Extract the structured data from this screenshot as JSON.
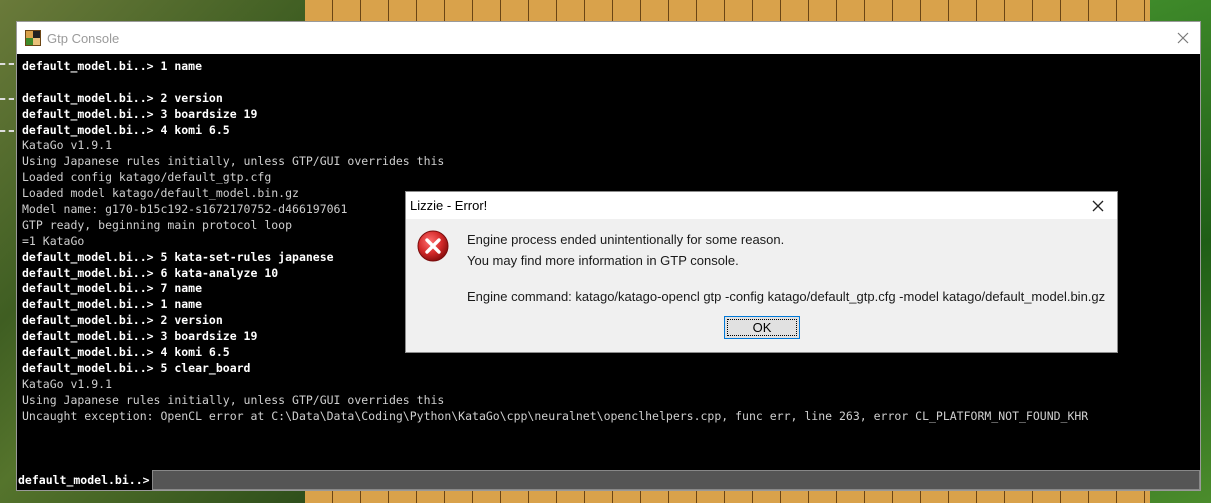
{
  "console": {
    "title": "Gtp Console",
    "log": [
      {
        "type": "cmd",
        "text": "default_model.bi..> 1 name"
      },
      {
        "type": "blank",
        "text": ""
      },
      {
        "type": "cmd",
        "text": "default_model.bi..> 2 version"
      },
      {
        "type": "cmd",
        "text": "default_model.bi..> 3 boardsize 19"
      },
      {
        "type": "cmd",
        "text": "default_model.bi..> 4 komi 6.5"
      },
      {
        "type": "out",
        "text": "KataGo v1.9.1"
      },
      {
        "type": "out",
        "text": "Using Japanese rules initially, unless GTP/GUI overrides this"
      },
      {
        "type": "out",
        "text": "Loaded config katago/default_gtp.cfg"
      },
      {
        "type": "out",
        "text": "Loaded model katago/default_model.bin.gz"
      },
      {
        "type": "out",
        "text": "Model name: g170-b15c192-s1672170752-d466197061"
      },
      {
        "type": "out",
        "text": "GTP ready, beginning main protocol loop"
      },
      {
        "type": "out",
        "text": "=1 KataGo"
      },
      {
        "type": "cmd",
        "text": "default_model.bi..> 5 kata-set-rules japanese"
      },
      {
        "type": "cmd",
        "text": "default_model.bi..> 6 kata-analyze 10"
      },
      {
        "type": "cmd",
        "text": "default_model.bi..> 7 name"
      },
      {
        "type": "cmd",
        "text": "default_model.bi..> 1 name"
      },
      {
        "type": "cmd",
        "text": "default_model.bi..> 2 version"
      },
      {
        "type": "cmd",
        "text": "default_model.bi..> 3 boardsize 19"
      },
      {
        "type": "cmd",
        "text": "default_model.bi..> 4 komi 6.5"
      },
      {
        "type": "cmd",
        "text": "default_model.bi..> 5 clear_board"
      },
      {
        "type": "out",
        "text": "KataGo v1.9.1"
      },
      {
        "type": "out",
        "text": "Using Japanese rules initially, unless GTP/GUI overrides this"
      },
      {
        "type": "out",
        "text": "Uncaught exception: OpenCL error at C:\\Data\\Data\\Coding\\Python\\KataGo\\cpp\\neuralnet\\openclhelpers.cpp, func err, line 263, error CL_PLATFORM_NOT_FOUND_KHR"
      }
    ],
    "prompt": "default_model.bi..>",
    "input_value": ""
  },
  "dialog": {
    "title": "Lizzie - Error!",
    "message_line1": "Engine process ended unintentionally for some reason.",
    "message_line2": "You may find more information in GTP console.",
    "command": "Engine command: katago/katago-opencl gtp -config katago/default_gtp.cfg -model katago/default_model.bin.gz",
    "ok_label": "OK"
  },
  "icons": {
    "window_close": "close-icon",
    "error": "error-icon",
    "app": "lizzie-app-icon"
  },
  "colors": {
    "console_bg": "#000000",
    "dialog_bg": "#f0f0f0",
    "error_red": "#d42a2a",
    "focus_blue": "#0078d7"
  }
}
